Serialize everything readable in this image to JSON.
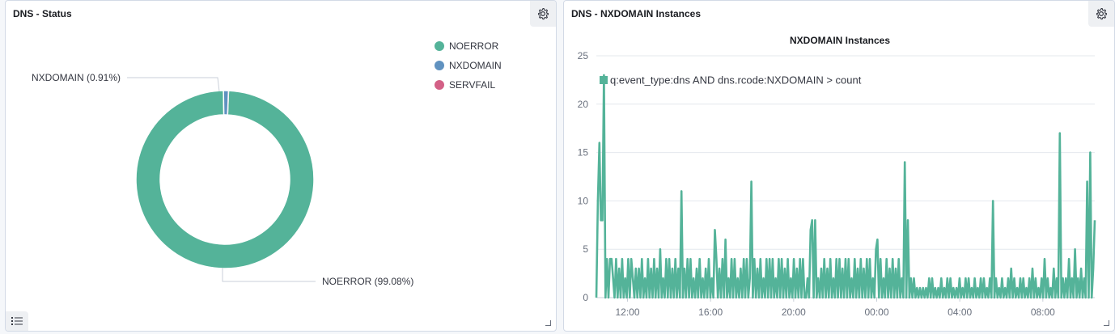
{
  "colors": {
    "noerror": "#54b399",
    "nxdomain": "#6092c0",
    "servfail": "#d36086"
  },
  "left_panel": {
    "title": "DNS - Status",
    "settings_icon": "gear-icon",
    "legend_toggle_icon": "list-icon",
    "legend": [
      {
        "label": "NOERROR",
        "color": "#54b399"
      },
      {
        "label": "NXDOMAIN",
        "color": "#6092c0"
      },
      {
        "label": "SERVFAIL",
        "color": "#d36086"
      }
    ],
    "chart_data": {
      "type": "pie",
      "style": "donut",
      "labels": [
        "NOERROR",
        "NXDOMAIN",
        "SERVFAIL"
      ],
      "values": [
        99.08,
        0.91,
        0.01
      ],
      "slice_labels": [
        "NOERROR (99.08%)",
        "NXDOMAIN (0.91%)"
      ],
      "legend_position": "top-right"
    }
  },
  "right_panel": {
    "title": "DNS - NXDOMAIN Instances",
    "settings_icon": "gear-icon",
    "chart_data": {
      "type": "line",
      "title": "NXDOMAIN Instances",
      "legend_position": "top-left",
      "grid": true,
      "ylim": [
        0,
        25
      ],
      "yticks": [
        "0",
        "5",
        "10",
        "15",
        "20",
        "25"
      ],
      "xticks": [
        "12:00",
        "16:00",
        "20:00",
        "00:00",
        "04:00",
        "08:00"
      ],
      "xrange_hours": [
        10.5,
        34.5
      ],
      "series": [
        {
          "name": "q:event_type:dns AND dns.rcode:NXDOMAIN > count",
          "color": "#54b399",
          "values": [
            0,
            10,
            16,
            8,
            8,
            23,
            0,
            4,
            0,
            4,
            4,
            2,
            0,
            4,
            0,
            3,
            0,
            4,
            0,
            2,
            0,
            4,
            0,
            4,
            2,
            0,
            3,
            0,
            3,
            0,
            4,
            0,
            2,
            0,
            4,
            0,
            3,
            0,
            4,
            0,
            3,
            0,
            5,
            0,
            2,
            0,
            4,
            0,
            4,
            0,
            3,
            0,
            4,
            0,
            3,
            0,
            11,
            0,
            3,
            0,
            4,
            0,
            4,
            0,
            2,
            0,
            3,
            0,
            4,
            0,
            2,
            0,
            3,
            0,
            4,
            0,
            2,
            0,
            7,
            4,
            0,
            3,
            0,
            4,
            0,
            6,
            0,
            2,
            0,
            4,
            0,
            4,
            0,
            2,
            0,
            3,
            0,
            4,
            0,
            4,
            0,
            2,
            12,
            0,
            4,
            0,
            3,
            0,
            4,
            0,
            2,
            0,
            4,
            0,
            4,
            0,
            4,
            0,
            2,
            0,
            4,
            0,
            4,
            0,
            3,
            0,
            4,
            0,
            2,
            0,
            4,
            0,
            3,
            0,
            4,
            0,
            4,
            0,
            0,
            2,
            0,
            7,
            8,
            0,
            8,
            0,
            2,
            0,
            3,
            0,
            4,
            0,
            3,
            0,
            4,
            0,
            2,
            0,
            4,
            0,
            4,
            0,
            3,
            0,
            4,
            0,
            4,
            0,
            2,
            0,
            4,
            0,
            3,
            0,
            4,
            0,
            3,
            0,
            4,
            0,
            4,
            0,
            2,
            0,
            5,
            6,
            0,
            4,
            0,
            2,
            0,
            4,
            0,
            3,
            0,
            4,
            0,
            3,
            0,
            4,
            0,
            2,
            0,
            14,
            0,
            8,
            0,
            2,
            0,
            2,
            0,
            1,
            0,
            1,
            0,
            1,
            0,
            1,
            0,
            2,
            0,
            2,
            0,
            1,
            0,
            1,
            0,
            2,
            0,
            1,
            0,
            2,
            0,
            2,
            0,
            1,
            0,
            1,
            0,
            2,
            0,
            1,
            0,
            2,
            0,
            2,
            0,
            1,
            0,
            2,
            0,
            1,
            0,
            2,
            0,
            2,
            0,
            1,
            0,
            2,
            0,
            10,
            0,
            2,
            0,
            1,
            0,
            2,
            0,
            1,
            0,
            2,
            0,
            3,
            0,
            2,
            0,
            1,
            0,
            2,
            0,
            2,
            0,
            1,
            0,
            2,
            0,
            3,
            0,
            2,
            0,
            1,
            0,
            2,
            0,
            4,
            0,
            2,
            0,
            1,
            0,
            3,
            0,
            2,
            0,
            17,
            0,
            2,
            0,
            2,
            0,
            4,
            0,
            2,
            0,
            5,
            0,
            2,
            0,
            3,
            0,
            2,
            0,
            12,
            0,
            15,
            0,
            3,
            8
          ]
        }
      ]
    }
  }
}
